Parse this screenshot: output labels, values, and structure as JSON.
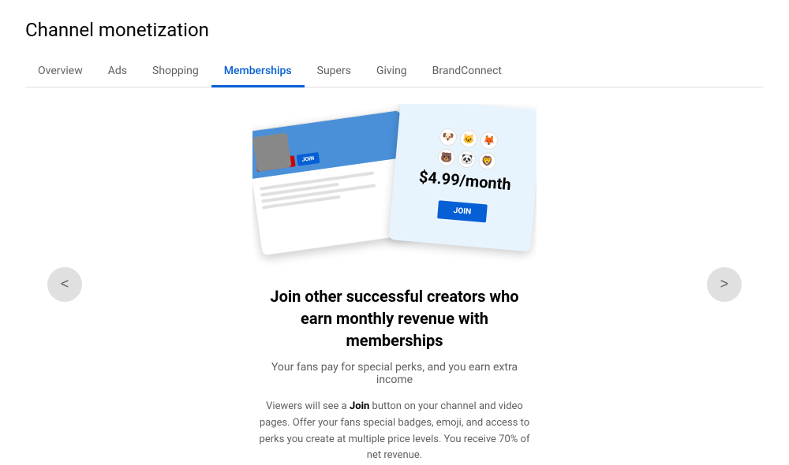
{
  "header": {
    "title": "Channel monetization"
  },
  "nav": {
    "tabs": [
      {
        "id": "overview",
        "label": "Overview",
        "active": false
      },
      {
        "id": "ads",
        "label": "Ads",
        "active": false
      },
      {
        "id": "shopping",
        "label": "Shopping",
        "active": false
      },
      {
        "id": "memberships",
        "label": "Memberships",
        "active": true
      },
      {
        "id": "supers",
        "label": "Supers",
        "active": false
      },
      {
        "id": "giving",
        "label": "Giving",
        "active": false
      },
      {
        "id": "brandconnect",
        "label": "BrandConnect",
        "active": false
      }
    ]
  },
  "slide": {
    "headline": "Join other successful creators who earn monthly revenue with memberships",
    "subtitle": "Your fans pay for special perks, and you earn extra income",
    "description_part1": "Viewers will see a ",
    "description_join": "Join",
    "description_part2": " button on your channel and video pages. Offer your fans special badges, emoji, and access to perks you create at multiple price levels. You receive 70% of net revenue.",
    "price": "$4.99/month"
  },
  "buttons": {
    "prev": "<",
    "next": ">"
  },
  "colors": {
    "active_tab": "#065fd4",
    "border": "#e0e0e0",
    "text_primary": "#030303",
    "text_secondary": "#606060"
  }
}
